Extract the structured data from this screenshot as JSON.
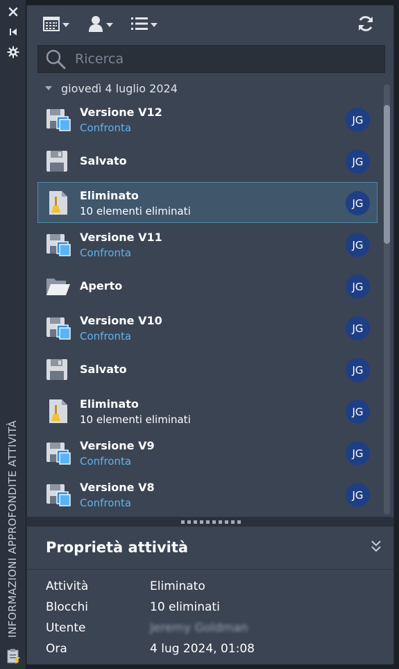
{
  "strip": {
    "title": "INFORMAZIONI APPROFONDITE ATTIVITÀ",
    "icons": [
      "close-icon",
      "collapse-panel-icon",
      "settings-icon",
      "clipboard-icon"
    ]
  },
  "toolbar": {
    "icons": [
      "calendar-icon",
      "user-filter-icon",
      "list-view-icon",
      "refresh-icon"
    ]
  },
  "search": {
    "placeholder": "Ricerca"
  },
  "list": {
    "date_header": "giovedì 4 luglio 2024",
    "rows": [
      {
        "icon": "version-icon",
        "title": "Versione V12",
        "subtitle": "Confronta",
        "subtitle_link": true,
        "avatar": "JG",
        "selected": false
      },
      {
        "icon": "save-icon",
        "title": "Salvato",
        "subtitle": "",
        "subtitle_link": false,
        "avatar": "JG",
        "selected": false
      },
      {
        "icon": "erase-icon",
        "title": "Eliminato",
        "subtitle": "10 elementi eliminati",
        "subtitle_link": false,
        "avatar": "JG",
        "selected": true
      },
      {
        "icon": "version-icon",
        "title": "Versione V11",
        "subtitle": "Confronta",
        "subtitle_link": true,
        "avatar": "JG",
        "selected": false
      },
      {
        "icon": "folder-open-icon",
        "title": "Aperto",
        "subtitle": "",
        "subtitle_link": false,
        "avatar": "JG",
        "selected": false
      },
      {
        "icon": "version-icon",
        "title": "Versione V10",
        "subtitle": "Confronta",
        "subtitle_link": true,
        "avatar": "JG",
        "selected": false
      },
      {
        "icon": "save-icon",
        "title": "Salvato",
        "subtitle": "",
        "subtitle_link": false,
        "avatar": "JG",
        "selected": false
      },
      {
        "icon": "erase-icon",
        "title": "Eliminato",
        "subtitle": "10 elementi eliminati",
        "subtitle_link": false,
        "avatar": "JG",
        "selected": false
      },
      {
        "icon": "version-icon",
        "title": "Versione V9",
        "subtitle": "Confronta",
        "subtitle_link": true,
        "avatar": "JG",
        "selected": false
      },
      {
        "icon": "version-icon",
        "title": "Versione V8",
        "subtitle": "Confronta",
        "subtitle_link": true,
        "avatar": "JG",
        "selected": false
      }
    ]
  },
  "properties": {
    "title": "Proprietà attività",
    "rows": [
      {
        "key": "Attività",
        "value": "Eliminato",
        "blurred": false
      },
      {
        "key": "Blocchi",
        "value": "10 eliminati",
        "blurred": false
      },
      {
        "key": "Utente",
        "value": "Jeremy Goldman",
        "blurred": true
      },
      {
        "key": "Ora",
        "value": "4 lug 2024, 01:08",
        "blurred": false
      }
    ]
  },
  "colors": {
    "panel_bg": "#3b4453",
    "link": "#5fb4ea",
    "avatar_bg": "#1f3f84",
    "selected_bg": "#40566b",
    "selected_border": "#4f89a8"
  }
}
